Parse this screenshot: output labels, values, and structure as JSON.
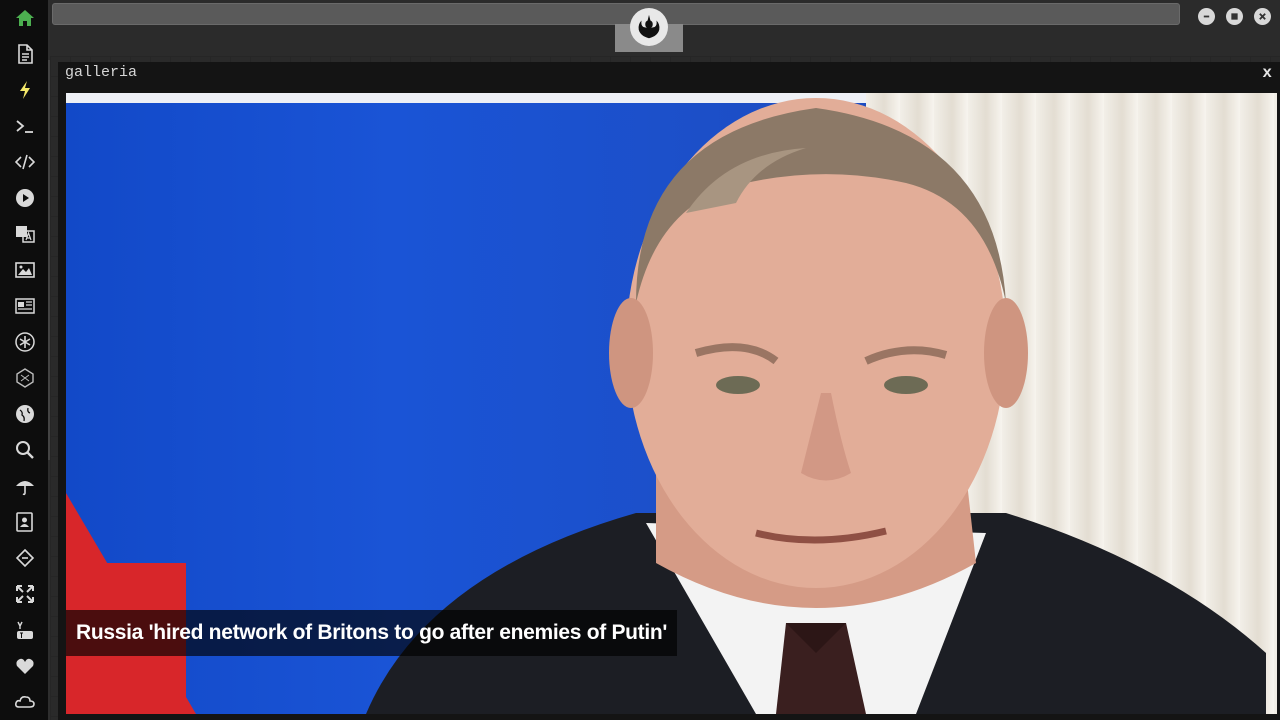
{
  "window": {
    "title": "galleria",
    "close_label": "x"
  },
  "gallery": {
    "caption": "Russia 'hired network of Britons to go after enemies of Putin'"
  },
  "sidebar": {
    "items": [
      {
        "icon": "home-icon"
      },
      {
        "icon": "document-icon"
      },
      {
        "icon": "lightning-icon"
      },
      {
        "icon": "terminal-icon"
      },
      {
        "icon": "code-icon"
      },
      {
        "icon": "play-icon"
      },
      {
        "icon": "translate-icon"
      },
      {
        "icon": "image-icon"
      },
      {
        "icon": "news-icon"
      },
      {
        "icon": "asterisk-icon"
      },
      {
        "icon": "hexagon-icon"
      },
      {
        "icon": "globe-icon"
      },
      {
        "icon": "search-icon"
      },
      {
        "icon": "umbrella-icon"
      },
      {
        "icon": "contacts-icon"
      },
      {
        "icon": "code-diamond-icon"
      },
      {
        "icon": "expand-icon"
      },
      {
        "icon": "youtube-icon"
      },
      {
        "icon": "heart-icon"
      },
      {
        "icon": "cloud-icon"
      }
    ]
  },
  "colors": {
    "home_active": "#4caf50",
    "sidebar_icon": "#d9d9d9",
    "lightning": "#f5e96a"
  }
}
